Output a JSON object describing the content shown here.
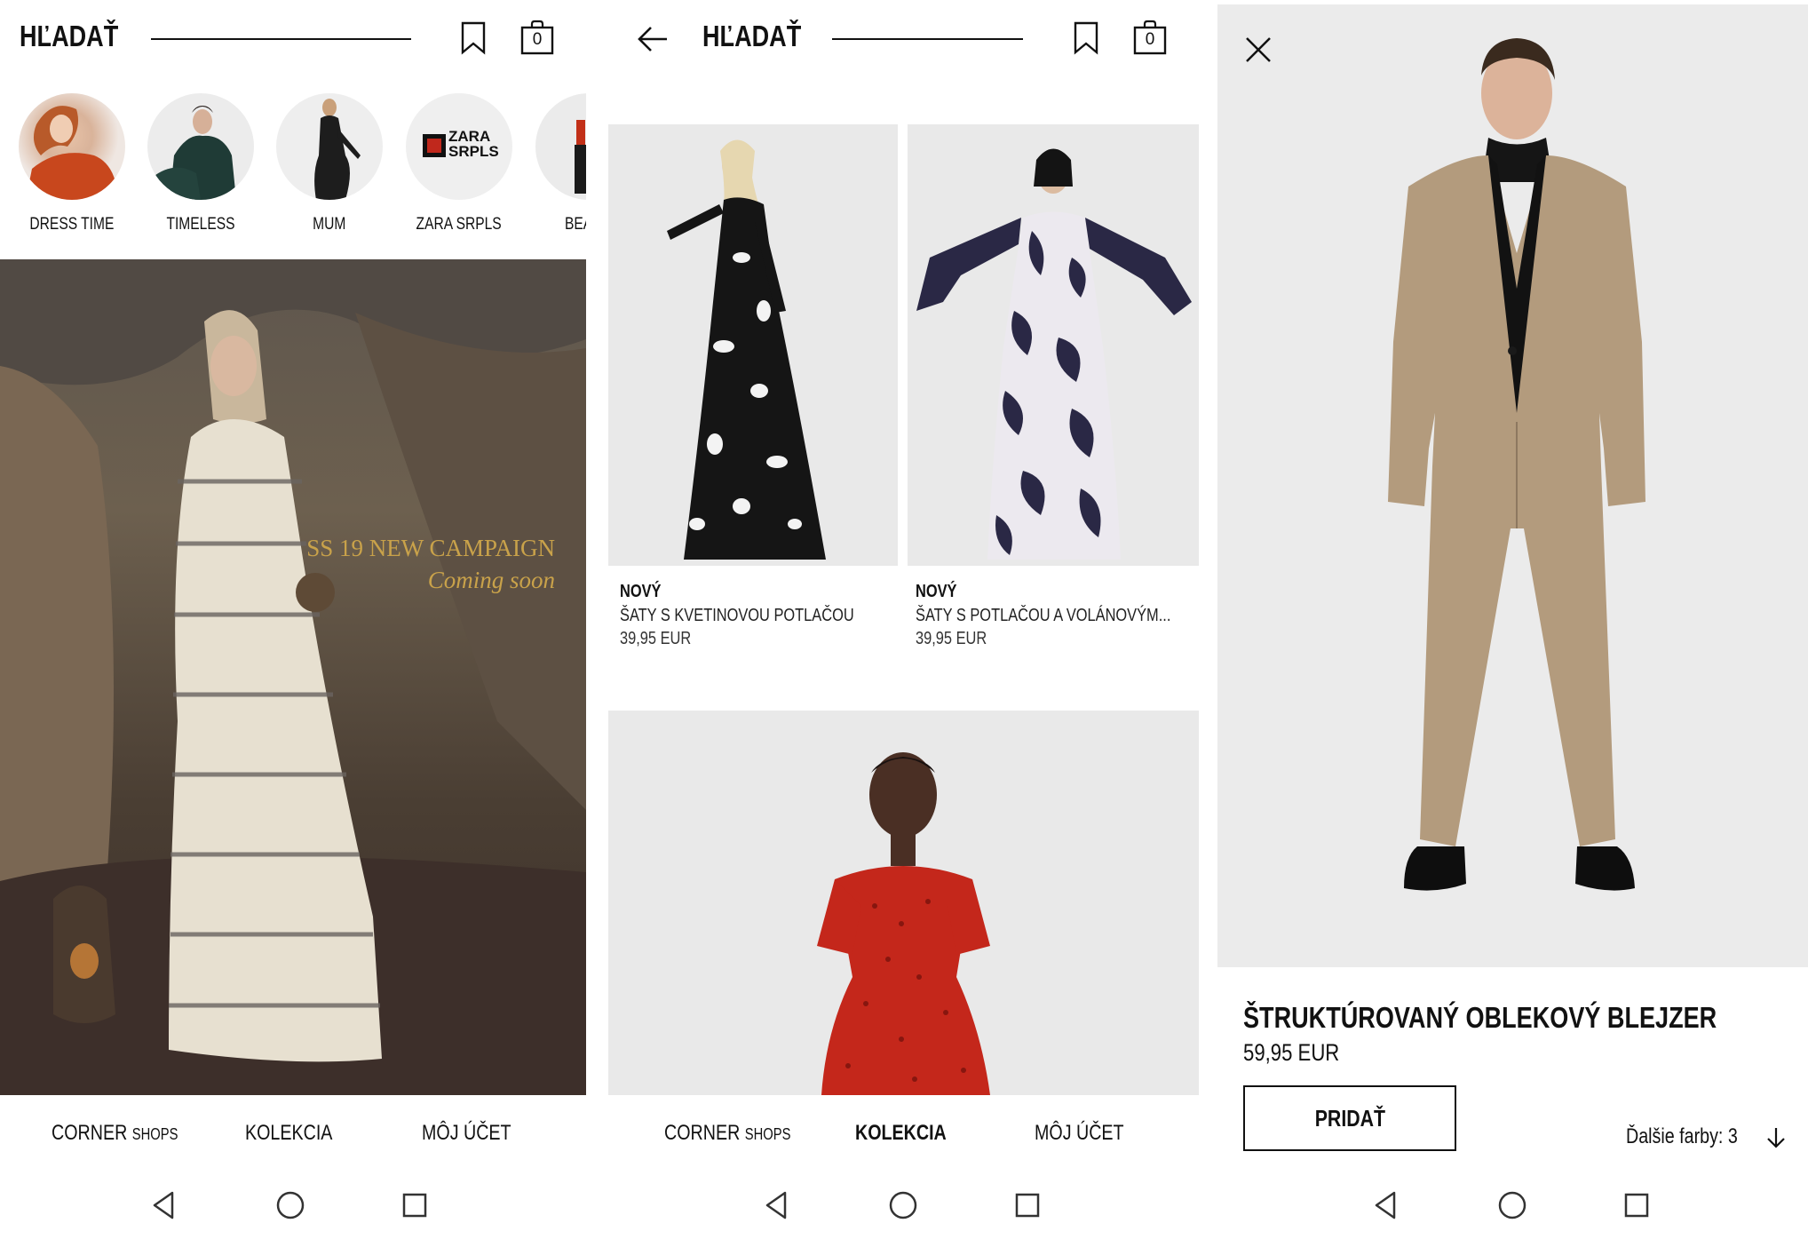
{
  "screen1": {
    "header": {
      "title": "HĽADAŤ",
      "bag_count": "0"
    },
    "stories": [
      {
        "label": "DRESS TIME"
      },
      {
        "label": "TIMELESS"
      },
      {
        "label": "MUM"
      },
      {
        "label": "ZARA SRPLS",
        "logo_line1": "ZARA",
        "logo_line2": "SRPLS"
      },
      {
        "label": "BEA"
      }
    ],
    "banner": {
      "line1": "SS 19 NEW CAMPAIGN",
      "line2": "Coming soon"
    },
    "nav": {
      "corner_main": "CORNER",
      "corner_sub": "SHOPS",
      "collection": "KOLEKCIA",
      "account": "MÔJ ÚČET"
    }
  },
  "screen2": {
    "header": {
      "title": "HĽADAŤ",
      "bag_count": "0"
    },
    "products": [
      {
        "tag": "NOVÝ",
        "name": "ŠATY S KVETINOVOU POTLAČOU",
        "price": "39,95 EUR"
      },
      {
        "tag": "NOVÝ",
        "name": "ŠATY S POTLAČOU A VOLÁNOVÝM...",
        "price": "39,95 EUR"
      }
    ],
    "nav": {
      "corner_main": "CORNER",
      "corner_sub": "SHOPS",
      "collection": "KOLEKCIA",
      "account": "MÔJ ÚČET"
    }
  },
  "screen3": {
    "product": {
      "name": "ŠTRUKTÚROVANÝ OBLEKOVÝ BLEJZER",
      "price": "59,95 EUR"
    },
    "add_button": "PRIDAŤ",
    "more_colors": "Ďalšie farby: 3"
  },
  "icons": [
    "bookmark-icon",
    "shopping-bag-icon",
    "back-arrow-icon",
    "close-icon",
    "arrow-down-icon",
    "nav-back-icon",
    "nav-home-icon",
    "nav-recents-icon"
  ],
  "colors": {
    "text": "#111111",
    "campaign_gold": "#c9a24a",
    "image_bg": "#e9e9e9"
  }
}
